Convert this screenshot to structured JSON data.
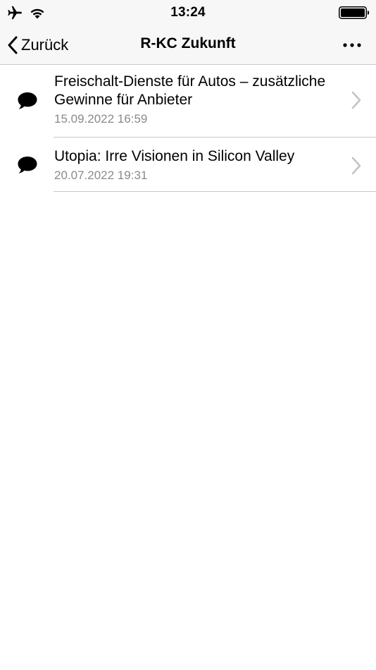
{
  "status_bar": {
    "time": "13:24",
    "icons": [
      "airplane-icon",
      "wifi-icon",
      "battery-icon"
    ]
  },
  "nav": {
    "back_label": "Zurück",
    "title": "R-KC Zukunft",
    "more_icon": "ellipsis-icon"
  },
  "items": [
    {
      "title": "Freischalt-Dienste für Autos – zusätzliche Gewinne für Anbieter",
      "date": "15.09.2022 16:59",
      "icon": "speech-bubble-icon"
    },
    {
      "title": "Utopia: Irre Visionen in Silicon Valley",
      "date": "20.07.2022 19:31",
      "icon": "speech-bubble-icon"
    }
  ],
  "colors": {
    "nav_background": "#f7f7f7",
    "separator": "#c8c7cc",
    "secondary_text": "#8a8a8e",
    "chevron": "#c4c4c7"
  }
}
